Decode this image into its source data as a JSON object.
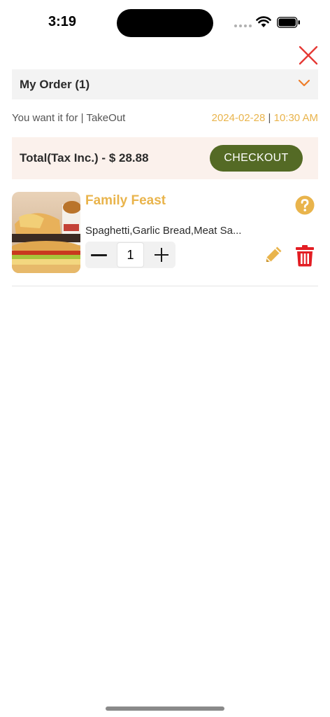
{
  "status_bar": {
    "time": "3:19"
  },
  "order": {
    "title": "My Order (1)",
    "want_label": "You want it for | TakeOut",
    "date": "2024-02-28",
    "separator": "|",
    "time": "10:30 AM"
  },
  "total": {
    "label": "Total(Tax Inc.) - $ 28.88",
    "checkout_label": "CHECKOUT"
  },
  "items": [
    {
      "name": "Family Feast",
      "description": "Spaghetti,Garlic Bread,Meat Sa...",
      "quantity": "1"
    }
  ],
  "colors": {
    "accent_yellow": "#e9b44c",
    "checkout_green": "#546a25",
    "close_red": "#e53935",
    "delete_red": "#e31e24",
    "chevron_orange": "#ee7d2a"
  },
  "icons": {
    "close": "close-icon",
    "chevron": "chevron-down-icon",
    "help": "question-circle-icon",
    "edit": "pencil-icon",
    "delete": "trash-icon"
  }
}
